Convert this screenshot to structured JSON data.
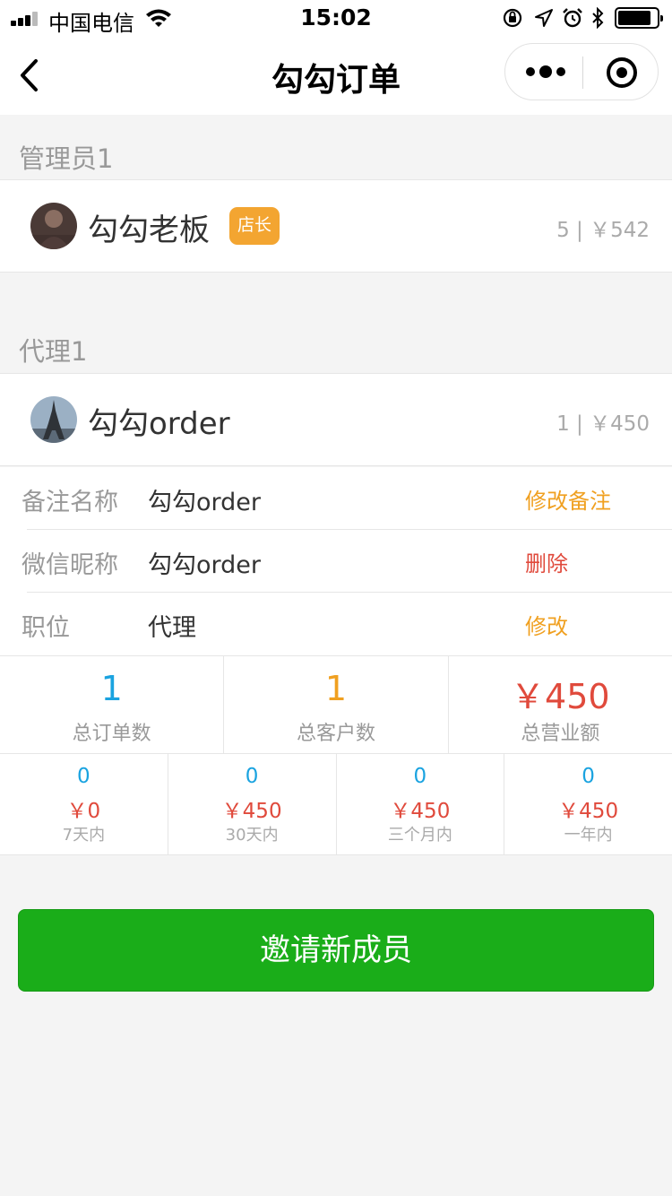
{
  "status_bar": {
    "carrier": "中国电信",
    "time": "15:02"
  },
  "nav": {
    "title": "勾勾订单"
  },
  "sections": {
    "admins": {
      "heading": "管理员1"
    },
    "agents": {
      "heading": "代理1"
    }
  },
  "admin": {
    "name": "勾勾老板",
    "badge": "店长",
    "stat": "5 | ￥542"
  },
  "agent": {
    "name": "勾勾order",
    "stat": "1 | ￥450"
  },
  "details": [
    {
      "label": "备注名称",
      "value": "勾勾order",
      "action": "修改备注",
      "action_color": "#f0a020"
    },
    {
      "label": "微信昵称",
      "value": "勾勾order",
      "action": "删除",
      "action_color": "#e04a3c"
    },
    {
      "label": "职位",
      "value": "代理",
      "action": "修改",
      "action_color": "#f0a020"
    }
  ],
  "totals": [
    {
      "value": "1",
      "label": "总订单数",
      "color": "#1aa3e0"
    },
    {
      "value": "1",
      "label": "总客户数",
      "color": "#f0a020"
    },
    {
      "value": "￥450",
      "label": "总营业额",
      "color": "#e04a3c"
    }
  ],
  "periods": [
    {
      "count": "0",
      "amount": "￥0",
      "label": "7天内"
    },
    {
      "count": "0",
      "amount": "￥450",
      "label": "30天内"
    },
    {
      "count": "0",
      "amount": "￥450",
      "label": "三个月内"
    },
    {
      "count": "0",
      "amount": "￥450",
      "label": "一年内"
    }
  ],
  "invite_button": "邀请新成员",
  "colors": {
    "primary_green": "#1aad19",
    "badge_orange": "#f3a531",
    "count_blue": "#1aa3e0",
    "amount_red": "#e04a3c"
  }
}
